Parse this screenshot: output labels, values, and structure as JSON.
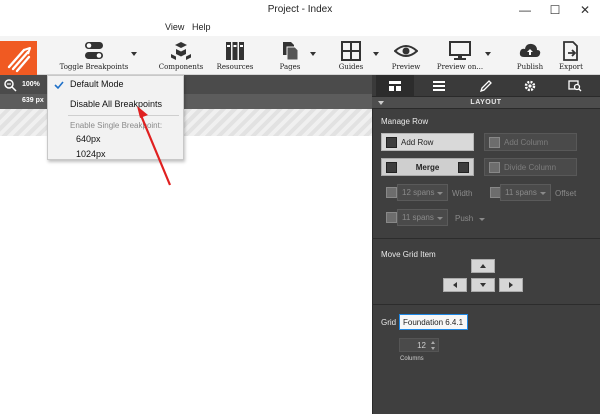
{
  "window": {
    "title": "Project - Index",
    "controls": {
      "minimize": "—",
      "maximize": "☐",
      "close": "✕"
    }
  },
  "menubar": {
    "items": [
      "View",
      "Help"
    ]
  },
  "toolbar": {
    "logo_icon": "bootstrap-studio-logo",
    "items": [
      {
        "label": "Toggle Breakpoints",
        "icon": "toggle-icon"
      },
      {
        "label": "Components",
        "icon": "components-icon"
      },
      {
        "label": "Resources",
        "icon": "resources-icon"
      },
      {
        "label": "Pages",
        "icon": "pages-icon"
      },
      {
        "label": "Guides",
        "icon": "guides-icon"
      },
      {
        "label": "Preview",
        "icon": "eye-icon"
      },
      {
        "label": "Preview on...",
        "icon": "monitor-icon"
      },
      {
        "label": "Publish",
        "icon": "cloud-upload-icon"
      },
      {
        "label": "Export",
        "icon": "export-icon"
      }
    ]
  },
  "viewport": {
    "zoom": "100%",
    "width": "639 px"
  },
  "breakpoint_menu": {
    "default_mode": "Default Mode",
    "default_checked": true,
    "disable_all": "Disable All Breakpoints",
    "single_heading": "Enable Single Breakpoint:",
    "options": [
      "640px",
      "1024px"
    ]
  },
  "panel": {
    "tabs": [
      "layout-tab-icon",
      "list-tab-icon",
      "brush-tab-icon",
      "gear-tab-icon",
      "inspect-tab-icon"
    ],
    "title": "LAYOUT",
    "manage_row": {
      "label": "Manage Row",
      "add_row": "Add Row",
      "add_column": "Add Column",
      "merge": "Merge",
      "divide_column": "Divide Column",
      "width_value": "12 spans",
      "width_label": "Width",
      "offset_value": "11 spans",
      "offset_label": "Offset",
      "push_value": "11 spans",
      "push_label": "Push"
    },
    "move_grid_item": {
      "label": "Move Grid Item"
    },
    "grid": {
      "label": "Grid",
      "framework": "Foundation 6.4.1",
      "columns_value": "12",
      "columns_label": "Columns"
    }
  },
  "colors": {
    "accent": "#f05a22",
    "panel_bg": "#3f3f3f",
    "arrow": "#e02020",
    "focus": "#1e88e5"
  }
}
